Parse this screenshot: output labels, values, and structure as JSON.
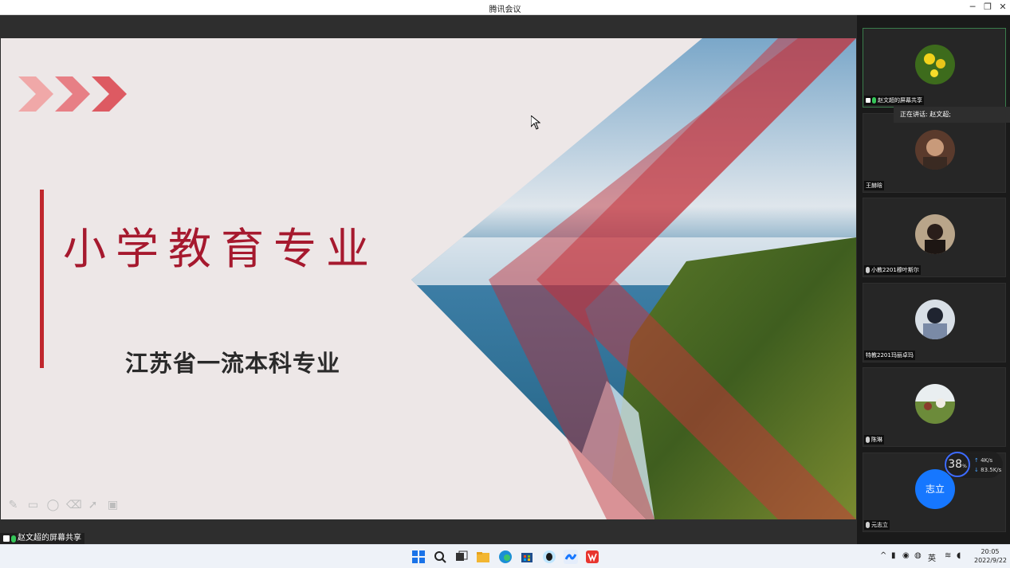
{
  "window": {
    "title": "腾讯会议"
  },
  "slide": {
    "title": "小学教育专业",
    "subtitle": "江苏省一流本科专业"
  },
  "share_tag": "赵文超的屏幕共享",
  "speaking_label": "正在讲话: 赵文超;",
  "participants": [
    {
      "name": "赵文超的屏幕共享"
    },
    {
      "name": "王赫晗"
    },
    {
      "name": "小教2201穆叶斯尔"
    },
    {
      "name": "特教2201玛丽卓玛"
    },
    {
      "name": "陈琳"
    },
    {
      "name": "元志立",
      "avatar_text": "志立"
    }
  ],
  "network": {
    "percent": "38",
    "percent_unit": "%",
    "up": "4",
    "up_unit": "K/s",
    "down": "83.5",
    "down_unit": "K/s"
  },
  "taskbar": {
    "ime": "英",
    "time": "20:05",
    "date": "2022/9/22"
  },
  "colors": {
    "accent_red": "#a6192e",
    "avatar_blue": "#1677ff",
    "active_border": "#3a7c4b"
  }
}
